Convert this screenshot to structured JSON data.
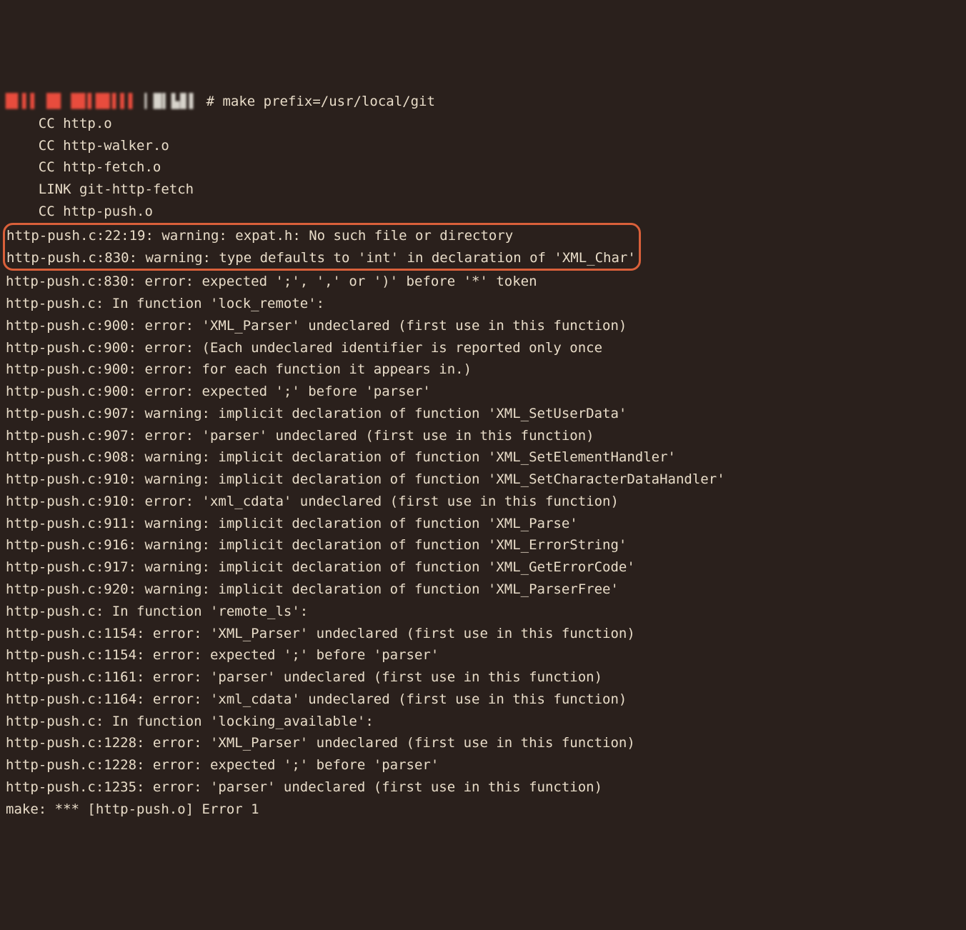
{
  "prompt": {
    "red_blur": "█▌▌▌ █▊ █▊▌█▊▌▌▌",
    "host_blur": "▎█▍▙▊▌",
    "char": "#",
    "command": "make prefix=/usr/local/git"
  },
  "indent": "    ",
  "compile_lines": [
    "CC http.o",
    "CC http-walker.o",
    "CC http-fetch.o",
    "LINK git-http-fetch",
    "CC http-push.o"
  ],
  "boxed_lines": [
    "http-push.c:22:19: warning: expat.h: No such file or directory",
    "http-push.c:830: warning: type defaults to 'int' in declaration of 'XML_Char'"
  ],
  "error_lines": [
    "http-push.c:830: error: expected ';', ',' or ')' before '*' token",
    "http-push.c: In function 'lock_remote':",
    "http-push.c:900: error: 'XML_Parser' undeclared (first use in this function)",
    "http-push.c:900: error: (Each undeclared identifier is reported only once",
    "http-push.c:900: error: for each function it appears in.)",
    "http-push.c:900: error: expected ';' before 'parser'",
    "http-push.c:907: warning: implicit declaration of function 'XML_SetUserData'",
    "http-push.c:907: error: 'parser' undeclared (first use in this function)",
    "http-push.c:908: warning: implicit declaration of function 'XML_SetElementHandler'",
    "http-push.c:910: warning: implicit declaration of function 'XML_SetCharacterDataHandler'",
    "http-push.c:910: error: 'xml_cdata' undeclared (first use in this function)",
    "http-push.c:911: warning: implicit declaration of function 'XML_Parse'",
    "http-push.c:916: warning: implicit declaration of function 'XML_ErrorString'",
    "http-push.c:917: warning: implicit declaration of function 'XML_GetErrorCode'",
    "http-push.c:920: warning: implicit declaration of function 'XML_ParserFree'",
    "http-push.c: In function 'remote_ls':",
    "http-push.c:1154: error: 'XML_Parser' undeclared (first use in this function)",
    "http-push.c:1154: error: expected ';' before 'parser'",
    "http-push.c:1161: error: 'parser' undeclared (first use in this function)",
    "http-push.c:1164: error: 'xml_cdata' undeclared (first use in this function)",
    "http-push.c: In function 'locking_available':",
    "http-push.c:1228: error: 'XML_Parser' undeclared (first use in this function)",
    "http-push.c:1228: error: expected ';' before 'parser'",
    "http-push.c:1235: error: 'parser' undeclared (first use in this function)",
    "make: *** [http-push.o] Error 1"
  ]
}
